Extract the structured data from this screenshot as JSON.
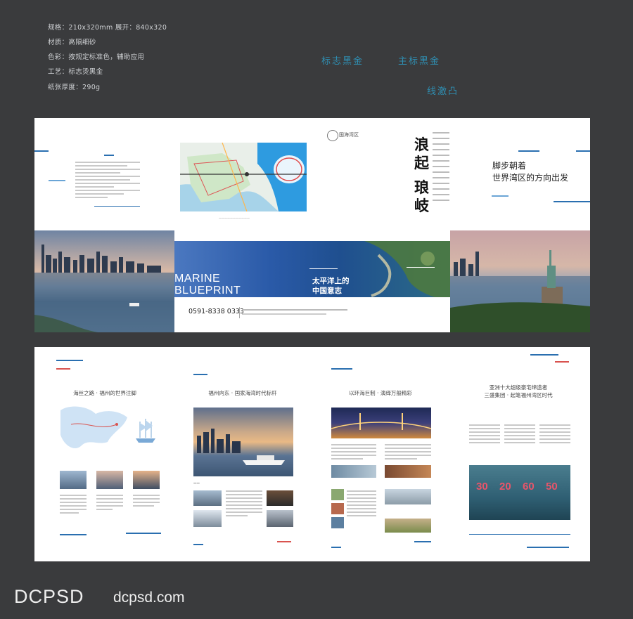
{
  "specs": [
    "规格：210x320mm 展开：840x320",
    "材质：高隔细砂",
    "色彩：按规定标准色，辅助应用",
    "工艺：标志烫黑金",
    "纸张厚度：290g"
  ],
  "annotations": {
    "logo_foil": "标志黑金",
    "main_logo_foil": "主标黑金",
    "line_emboss": "线激凸"
  },
  "outer_spread": {
    "logo_text": "国海湾区",
    "vertical_title_1": "浪起",
    "vertical_title_2": "琅岐",
    "slogan_line_1": "脚步朝着",
    "slogan_line_2": "世界湾区的方向出发",
    "cover_en_1": "MARINE",
    "cover_en_2": "BLUEPRINT",
    "cover_cn_1": "太平洋上的",
    "cover_cn_2": "中国意志",
    "phone": "0591-8338 0333"
  },
  "inner_spread": {
    "panel1_title": "海丝之路 · 福州的世界注脚",
    "panel2_title": "福州向东 · 国家海湾时代标杆",
    "panel3_title": "以环海巨制 · 演绎万般精彩",
    "panel4_title_1": "亚洲十大超级豪宅缔造者",
    "panel4_title_2": "三盛集团 · 起笔福州湾区时代",
    "stats": [
      "30",
      "20",
      "60",
      "50"
    ]
  },
  "brand": {
    "logo": "DCPSD",
    "url": "dcpsd.com"
  },
  "colors": {
    "background": "#3a3b3d",
    "accent_blue": "#2a6fb0",
    "accent_red": "#d9534f",
    "annotation": "#2f8fb3"
  }
}
